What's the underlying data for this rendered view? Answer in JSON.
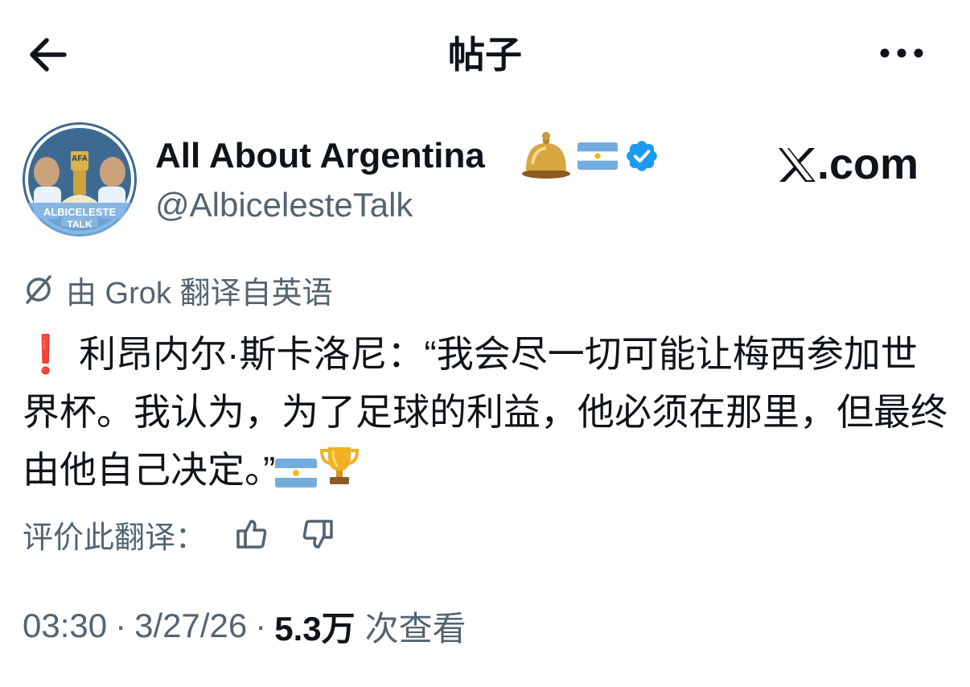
{
  "header": {
    "title": "帖子",
    "back_icon": "back-arrow-icon",
    "more_icon": "more-dots-icon"
  },
  "author": {
    "name": "All About Argentina",
    "handle": "@AlbicelesteTalk",
    "avatar_text_top": "ALBICELESTE",
    "avatar_text_bottom": "TALK",
    "avatar_badge": "AFA",
    "badges": [
      "bell-emoji",
      "argentina-flag-emoji",
      "verified-badge-icon"
    ]
  },
  "watermark": {
    "label": ".com",
    "logo_icon": "x-logo-icon"
  },
  "translation": {
    "notice": "由 Grok 翻译自英语",
    "icon": "grok-icon"
  },
  "tweet": {
    "text": "利昂内尔·斯卡洛尼：“我会尽一切可能让梅西参加世界杯。我认为，为了足球的利益，他必须在那里，但最终由他自己决定。”",
    "leading_emoji": "❗",
    "trailing_emojis": [
      "argentina-flag-emoji",
      "trophy-emoji"
    ]
  },
  "rating": {
    "label": "评价此翻译：",
    "thumbs_up_icon": "thumbs-up-icon",
    "thumbs_down_icon": "thumbs-down-icon"
  },
  "meta": {
    "time": "03:30",
    "date": "3/27/26",
    "sep": "·",
    "views_count": "5.3万",
    "views_label": "次查看"
  },
  "colors": {
    "text": "#0f1419",
    "secondary": "#536471",
    "verified": "#1d9bf0",
    "argentina_blue": "#74acdf"
  }
}
